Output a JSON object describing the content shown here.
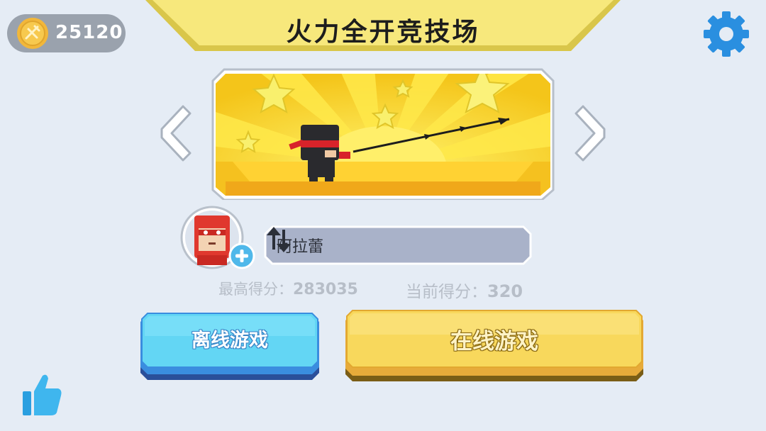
{
  "header": {
    "coins": "25120",
    "title": "火力全开竞技场"
  },
  "icons": {
    "coin": "coin-icon",
    "settings": "gear-icon",
    "prev": "chevron-left-icon",
    "next": "chevron-right-icon",
    "add_avatar": "plus-icon",
    "swap_name": "swap-arrows-icon",
    "like": "thumbs-up-icon"
  },
  "player": {
    "name": "阿拉蕾"
  },
  "scores": {
    "best_label": "最高得分：",
    "best_value": "283035",
    "current_label": "当前得分：",
    "current_value": "320"
  },
  "buttons": {
    "offline": "离线游戏",
    "online": "在线游戏"
  },
  "colors": {
    "background": "#e5ecf5",
    "banner": "#d9c64a",
    "settings_blue": "#2a8fe0",
    "offline_button": "#63d6f4",
    "online_button": "#f5d55a"
  }
}
